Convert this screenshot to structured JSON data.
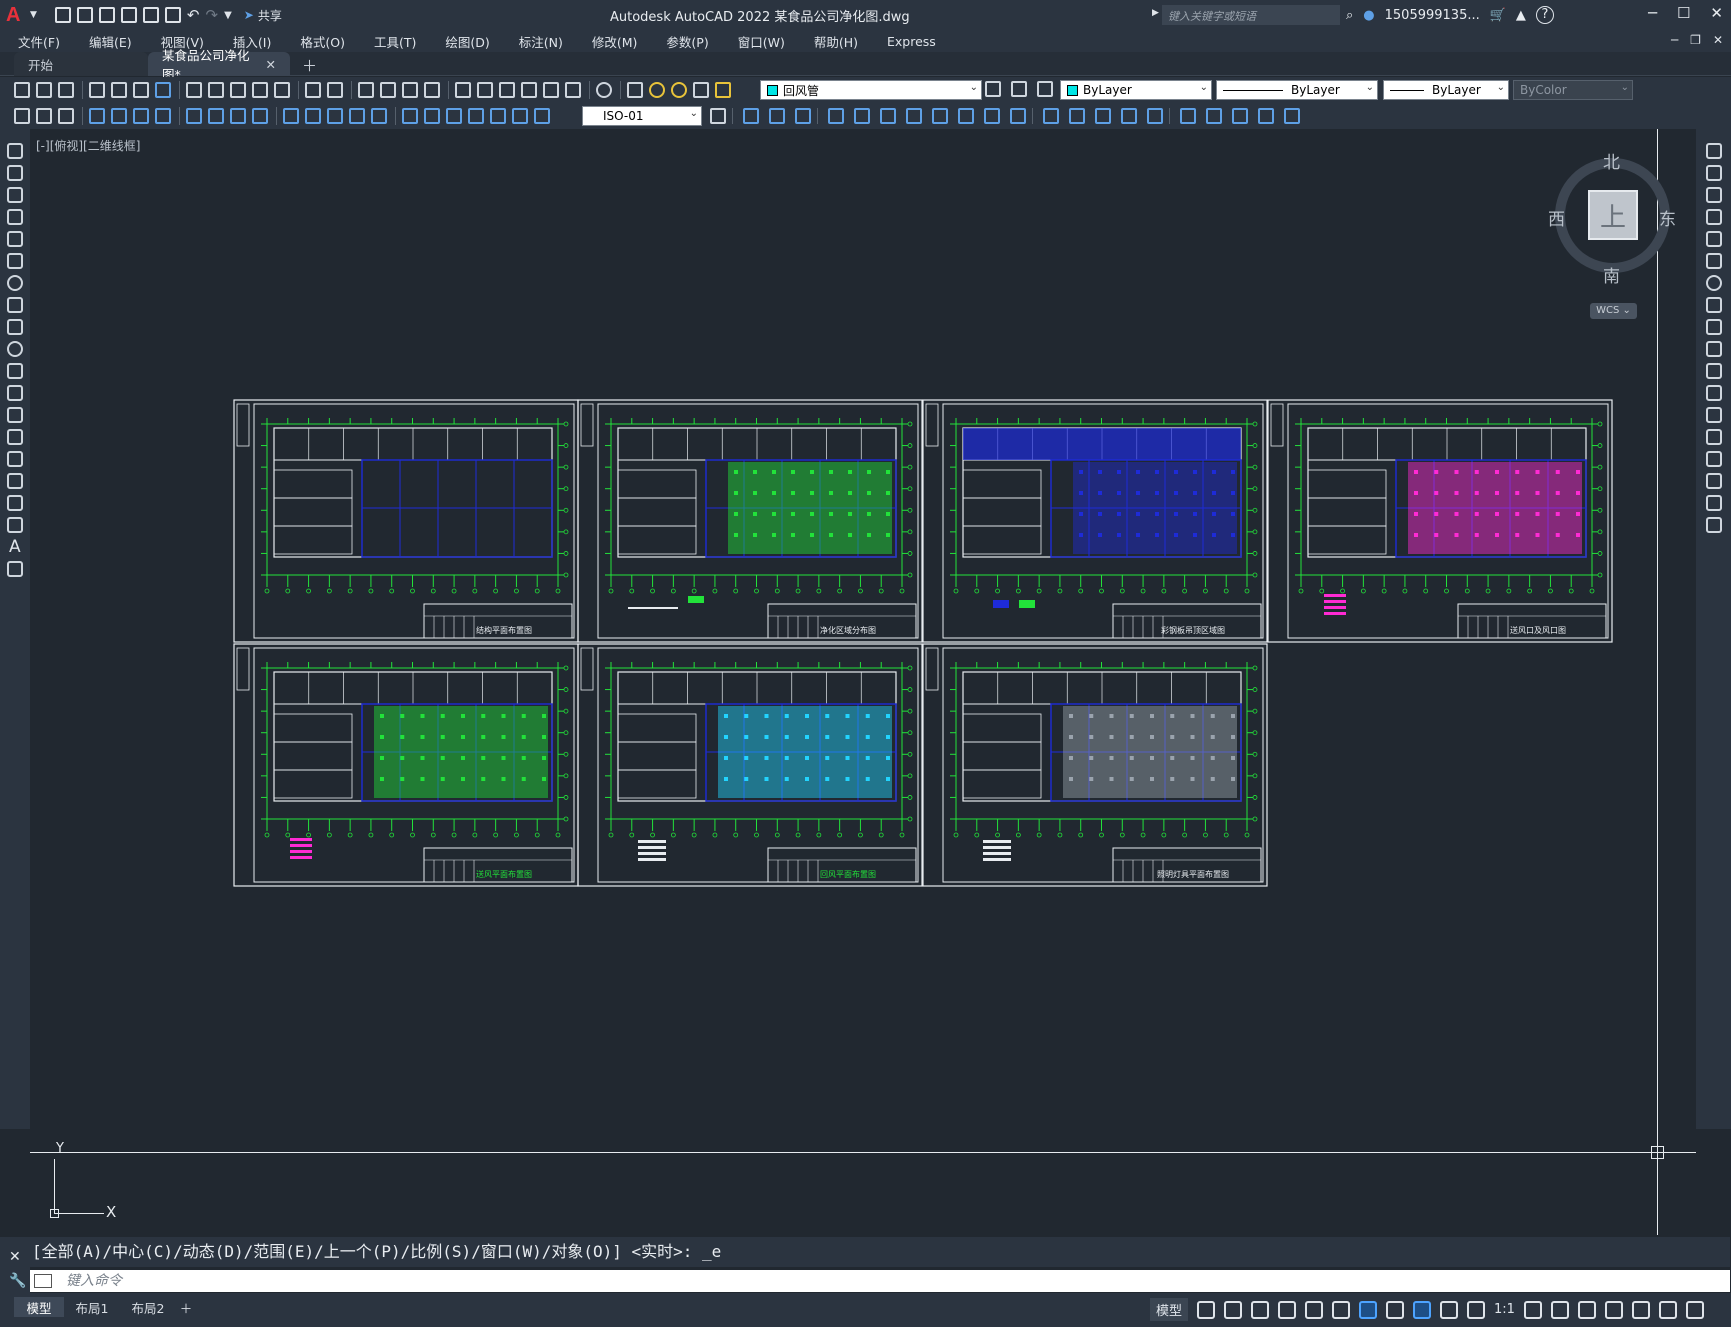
{
  "titlebar": {
    "app_logo": "A",
    "share_label": "共享",
    "title": "Autodesk AutoCAD 2022    某食品公司净化图.dwg",
    "search_placeholder": "键入关键字或短语",
    "user": "1505999135...",
    "help": "?"
  },
  "menu": [
    "文件(F)",
    "编辑(E)",
    "视图(V)",
    "插入(I)",
    "格式(O)",
    "工具(T)",
    "绘图(D)",
    "标注(N)",
    "修改(M)",
    "参数(P)",
    "窗口(W)",
    "帮助(H)",
    "Express"
  ],
  "tabs": {
    "start": "开始",
    "active": "某食品公司净化图*"
  },
  "toolbar": {
    "layer_combo": "回风管",
    "layer_color": "#00e5e5",
    "color_combo": "ByLayer",
    "linetype_combo": "ByLayer",
    "lineweight_combo": "ByLayer",
    "plotstyle_combo": "ByColor",
    "dimstyle_combo": "ISO-01"
  },
  "viewport": {
    "label": "[-][俯视][二维线框]",
    "axis_y": "Y",
    "axis_x": "X"
  },
  "viewcube": {
    "north": "北",
    "south": "南",
    "east": "东",
    "west": "西",
    "face": "上",
    "wcs": "WCS"
  },
  "command": {
    "history": "[全部(A)/中心(C)/动态(D)/范围(E)/上一个(P)/比例(S)/窗口(W)/对象(O)] <实时>: _e",
    "placeholder": "键入命令"
  },
  "layout_tabs": [
    "模型",
    "布局1",
    "布局2"
  ],
  "status": {
    "model_label": "模型",
    "scale": "1:1"
  },
  "drawings": [
    {
      "title": "结构平面布置图"
    },
    {
      "title": "净化区域分布图"
    },
    {
      "title": "彩钢板吊顶区域图"
    },
    {
      "title": "送风口及风口图"
    },
    {
      "title": "送风平面布置图"
    },
    {
      "title": "回风平面布置图"
    },
    {
      "title": "照明灯具平面布置图"
    }
  ],
  "colors": {
    "grid_green": "#22e23a",
    "wall_blue": "#1e2bd8",
    "frame_white": "#e8ecf0",
    "magenta": "#ff2ad4",
    "cyan": "#22d4ff"
  }
}
